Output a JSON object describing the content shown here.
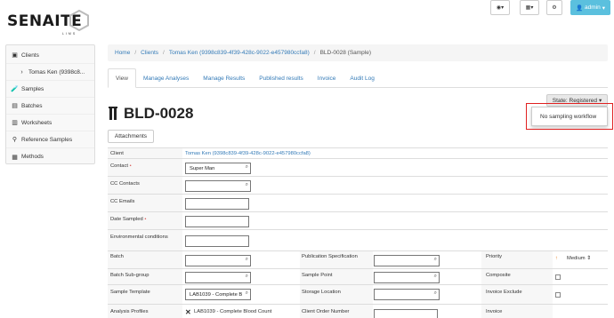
{
  "brand": {
    "name": "SENAITE",
    "sub": "LIMS"
  },
  "topbar": {
    "globe_caret": "▾",
    "grid_caret": "▾",
    "user_label": "admin",
    "user_caret": "▾"
  },
  "sidebar": {
    "items": [
      {
        "label": "Clients"
      },
      {
        "label": "Tomas Ken (9398c8..."
      },
      {
        "label": "Samples"
      },
      {
        "label": "Batches"
      },
      {
        "label": "Worksheets"
      },
      {
        "label": "Reference Samples"
      },
      {
        "label": "Methods"
      }
    ]
  },
  "breadcrumb": {
    "items": [
      "Home",
      "Clients",
      "Tomas Ken (9398c839-4f39-428c-9022-e457980ccfa8)",
      "BLD-0028 (Sample)"
    ]
  },
  "tabs": [
    "View",
    "Manage Analyses",
    "Manage Results",
    "Published results",
    "Invoice",
    "Audit Log"
  ],
  "title": "BLD-0028",
  "attachments_label": "Attachments",
  "state": {
    "label": "State: Registered",
    "caret": "▾",
    "menu_item": "No sampling workflow"
  },
  "form": {
    "client_label": "Client",
    "client_value": "Tomas Ken (9398c839-4f39-428c-9022-e457980ccfa8)",
    "contact_label": "Contact",
    "contact_value": "Super Man",
    "cc_contacts_label": "CC Contacts",
    "cc_emails_label": "CC Emails",
    "date_sampled_label": "Date Sampled",
    "env_label": "Environmental conditions",
    "batch_label": "Batch",
    "pub_spec_label": "Publication Specification",
    "priority_label": "Priority",
    "priority_value": "Medium",
    "batch_subgroup_label": "Batch Sub-group",
    "sample_point_label": "Sample Point",
    "composite_label": "Composite",
    "sample_template_label": "Sample Template",
    "sample_template_value": "LAB1039 - Complete B",
    "storage_label": "Storage Location",
    "invoice_exclude_label": "Invoice Exclude",
    "analysis_profiles_label": "Analysis Profiles",
    "analysis_profiles_value": "LAB1039 - Complete Blood Count",
    "client_order_label": "Client Order Number",
    "invoice_label": "Invoice",
    "required_mark": "•"
  }
}
